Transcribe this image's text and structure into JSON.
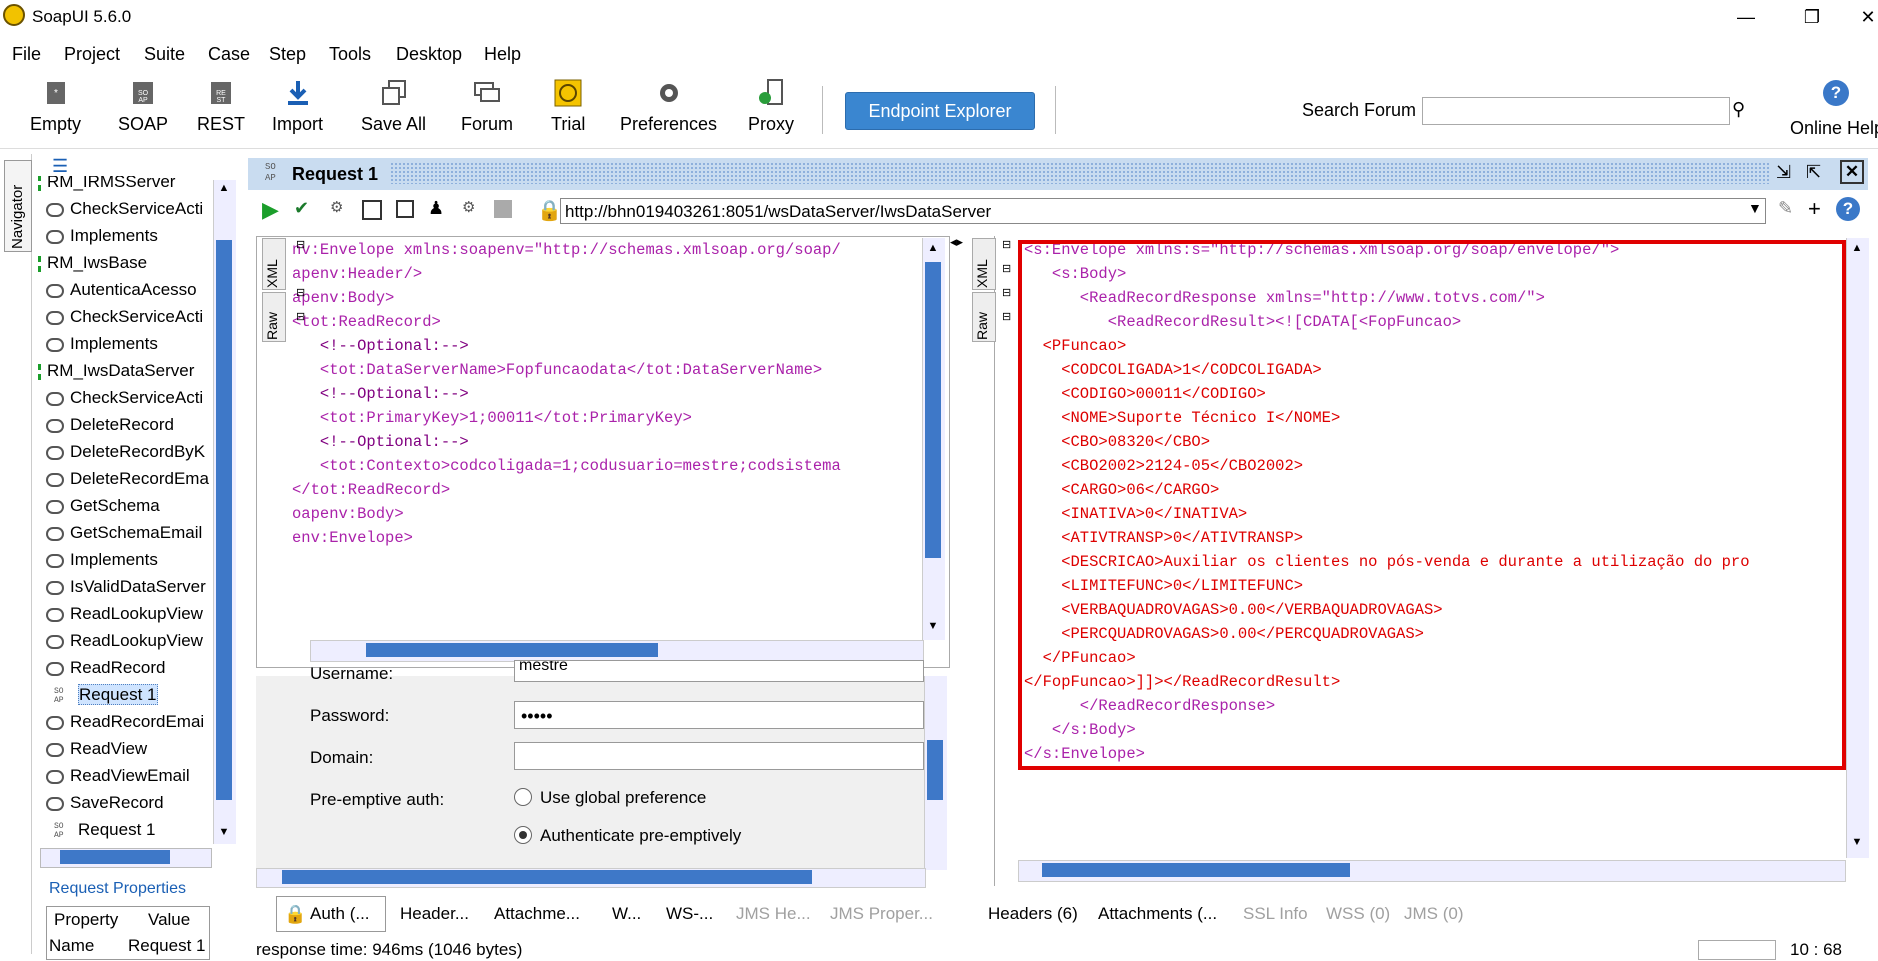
{
  "window": {
    "title": "SoapUI 5.6.0",
    "minimize": "—",
    "restore": "❐",
    "close": "✕"
  },
  "menu": [
    "File",
    "Project",
    "Suite",
    "Case",
    "Step",
    "Tools",
    "Desktop",
    "Help"
  ],
  "toolbar": {
    "items": [
      "Empty",
      "SOAP",
      "REST",
      "Import",
      "Save All",
      "Forum",
      "Trial",
      "Preferences",
      "Proxy"
    ],
    "endpoint_explorer": "Endpoint Explorer",
    "search_label": "Search Forum",
    "search_placeholder": "",
    "online_help": "Online Help"
  },
  "navigator": {
    "label": "Navigator",
    "tree": [
      {
        "label": "RM_IRMSServer",
        "kind": "interface"
      },
      {
        "label": "CheckServiceActi",
        "kind": "op"
      },
      {
        "label": "Implements",
        "kind": "op"
      },
      {
        "label": "RM_IwsBase",
        "kind": "interface"
      },
      {
        "label": "AutenticaAcesso",
        "kind": "op"
      },
      {
        "label": "CheckServiceActi",
        "kind": "op"
      },
      {
        "label": "Implements",
        "kind": "op"
      },
      {
        "label": "RM_IwsDataServer",
        "kind": "interface"
      },
      {
        "label": "CheckServiceActi",
        "kind": "op"
      },
      {
        "label": "DeleteRecord",
        "kind": "op"
      },
      {
        "label": "DeleteRecordByK",
        "kind": "op"
      },
      {
        "label": "DeleteRecordEma",
        "kind": "op"
      },
      {
        "label": "GetSchema",
        "kind": "op"
      },
      {
        "label": "GetSchemaEmail",
        "kind": "op"
      },
      {
        "label": "Implements",
        "kind": "op"
      },
      {
        "label": "IsValidDataServer",
        "kind": "op"
      },
      {
        "label": "ReadLookupView",
        "kind": "op"
      },
      {
        "label": "ReadLookupView",
        "kind": "op"
      },
      {
        "label": "ReadRecord",
        "kind": "op"
      },
      {
        "label": "Request 1",
        "kind": "request",
        "selected": true
      },
      {
        "label": "ReadRecordEmai",
        "kind": "op"
      },
      {
        "label": "ReadView",
        "kind": "op"
      },
      {
        "label": "ReadViewEmail",
        "kind": "op"
      },
      {
        "label": "SaveRecord",
        "kind": "op"
      },
      {
        "label": "Request 1",
        "kind": "request"
      }
    ],
    "props_title": "Request Properties",
    "props_header": [
      "Property",
      "Value"
    ],
    "props_row": [
      "Name",
      "Request 1"
    ]
  },
  "request": {
    "title": "Request 1",
    "url": "http://bhn019403261:8051/wsDataServer/IwsDataServer",
    "left_tabs": [
      "XML",
      "Raw"
    ],
    "right_tabs": [
      "XML",
      "Raw"
    ],
    "request_lines": [
      "nv:Envelope xmlns:soapenv=\"http://schemas.xmlsoap.org/soap/",
      "apenv:Header/>",
      "apenv:Body>",
      "<tot:ReadRecord>",
      "   <!--Optional:-->",
      "   <tot:DataServerName>Fopfuncaodata</tot:DataServerName>",
      "   <!--Optional:-->",
      "   <tot:PrimaryKey>1;00011</tot:PrimaryKey>",
      "   <!--Optional:-->",
      "   <tot:Contexto>codcoligada=1;codusuario=mestre;codsistema",
      "</tot:ReadRecord>",
      "oapenv:Body>",
      "env:Envelope>"
    ],
    "response_lines": [
      "<s:Envelope xmlns:s=\"http://schemas.xmlsoap.org/soap/envelope/\">",
      "   <s:Body>",
      "      <ReadRecordResponse xmlns=\"http://www.totvs.com/\">",
      "         <ReadRecordResult><![CDATA[<FopFuncao>",
      "  <PFuncao>",
      "    <CODCOLIGADA>1</CODCOLIGADA>",
      "    <CODIGO>00011</CODIGO>",
      "    <NOME>Suporte Técnico I</NOME>",
      "    <CBO>08320</CBO>",
      "    <CBO2002>2124-05</CBO2002>",
      "    <CARGO>06</CARGO>",
      "    <INATIVA>0</INATIVA>",
      "    <ATIVTRANSP>0</ATIVTRANSP>",
      "    <DESCRICAO>Auxiliar os clientes no pós-venda e durante a utilização do pro",
      "    <LIMITEFUNC>0</LIMITEFUNC>",
      "    <VERBAQUADROVAGAS>0.00</VERBAQUADROVAGAS>",
      "    <PERCQUADROVAGAS>0.00</PERCQUADROVAGAS>",
      "  </PFuncao>",
      "</FopFuncao>]]></ReadRecordResult>",
      "      </ReadRecordResponse>",
      "   </s:Body>",
      "</s:Envelope>"
    ],
    "auth": {
      "username_label": "Username:",
      "username_value": "mestre",
      "password_label": "Password:",
      "password_value": "•••••",
      "domain_label": "Domain:",
      "domain_value": "",
      "preemptive_label": "Pre-emptive auth:",
      "opt_global": "Use global preference",
      "opt_preemptive": "Authenticate pre-emptively"
    },
    "left_bottom_tabs": [
      "Auth (...",
      "Header...",
      "Attachme...",
      "W...",
      "WS-...",
      "JMS He...",
      "JMS Proper..."
    ],
    "right_bottom_tabs": [
      "Headers (6)",
      "Attachments (...",
      "SSL Info",
      "WSS (0)",
      "JMS (0)"
    ],
    "status": "response time: 946ms (1046 bytes)",
    "position": "10 : 68"
  },
  "colors": {
    "accent": "#3a86d0",
    "highlight_box": "#e00000",
    "tag": "#aa22aa",
    "string": "#dd0000"
  }
}
